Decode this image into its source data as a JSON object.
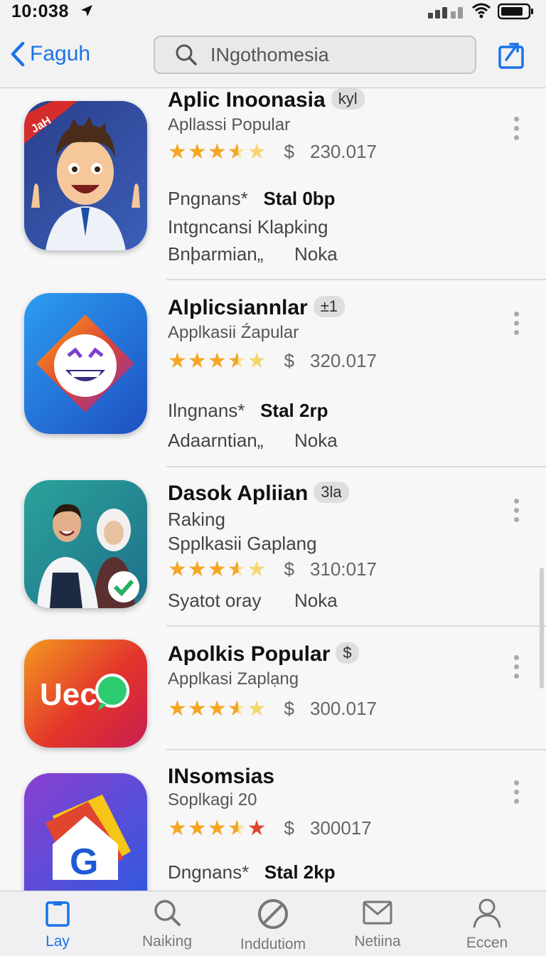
{
  "status_bar": {
    "time": "10:038",
    "location_icon": "location-arrow-icon",
    "signal_icon": "signal-icon",
    "wifi_icon": "wifi-icon",
    "battery_icon": "battery-icon"
  },
  "nav": {
    "back_label": "Faguh",
    "search_value": "INgothomesia",
    "share_icon": "share-icon"
  },
  "apps": [
    {
      "title": "Aplic Inoonasia",
      "badge": "kyl",
      "subtitle": "Apllassi Popular",
      "rating": 3.5,
      "price_symbol": "$",
      "price": "230.017",
      "line1_label": "Pngnans*",
      "line1_value": "Stal 0bp",
      "line2": "Intgncansi Klapking",
      "line3_label": "Bnþarmian„",
      "line3_value": "Noka",
      "icon_badge": "JaH"
    },
    {
      "title": "Alplicsiannlar",
      "badge": "±1",
      "subtitle": "Applkasii Źapular",
      "rating": 3.5,
      "price_symbol": "$",
      "price": "320.017",
      "line1_label": "Ilngnans*",
      "line1_value": "Stal 2rp",
      "line3_label": "Adaarntian„",
      "line3_value": "Noka"
    },
    {
      "title": "Dasok Apliian",
      "badge": "3la",
      "subtitle": "Raking",
      "subtitle2": "Spplkasii Gaplang",
      "rating": 3.5,
      "price_symbol": "$",
      "price": "310:017",
      "line3_label": "Syatot oray",
      "line3_value": "Noka"
    },
    {
      "title": "Apolkis Popular",
      "badge": "$",
      "subtitle": "Applkasi Zaplạng",
      "rating": 3.5,
      "price_symbol": "$",
      "price": "300.017",
      "icon_text": "Uec"
    },
    {
      "title": "INsomsias",
      "subtitle": "Soplkagi 20",
      "rating": 3.5,
      "price_symbol": "$",
      "price": "300017",
      "line1_label": "Dngnans*",
      "line1_value": "Stal 2kp",
      "icon_text": "G"
    }
  ],
  "tabs": [
    {
      "label": "Lay",
      "icon": "today-clipboard-icon",
      "active": true
    },
    {
      "label": "Naiking",
      "icon": "search-icon",
      "active": false
    },
    {
      "label": "Inddutiom",
      "icon": "prohibited-icon",
      "active": false
    },
    {
      "label": "Netiina",
      "icon": "mail-icon",
      "active": false
    },
    {
      "label": "Eccen",
      "icon": "person-icon",
      "active": false
    }
  ],
  "colors": {
    "accent": "#1a73e8",
    "star": "#f5a623"
  }
}
